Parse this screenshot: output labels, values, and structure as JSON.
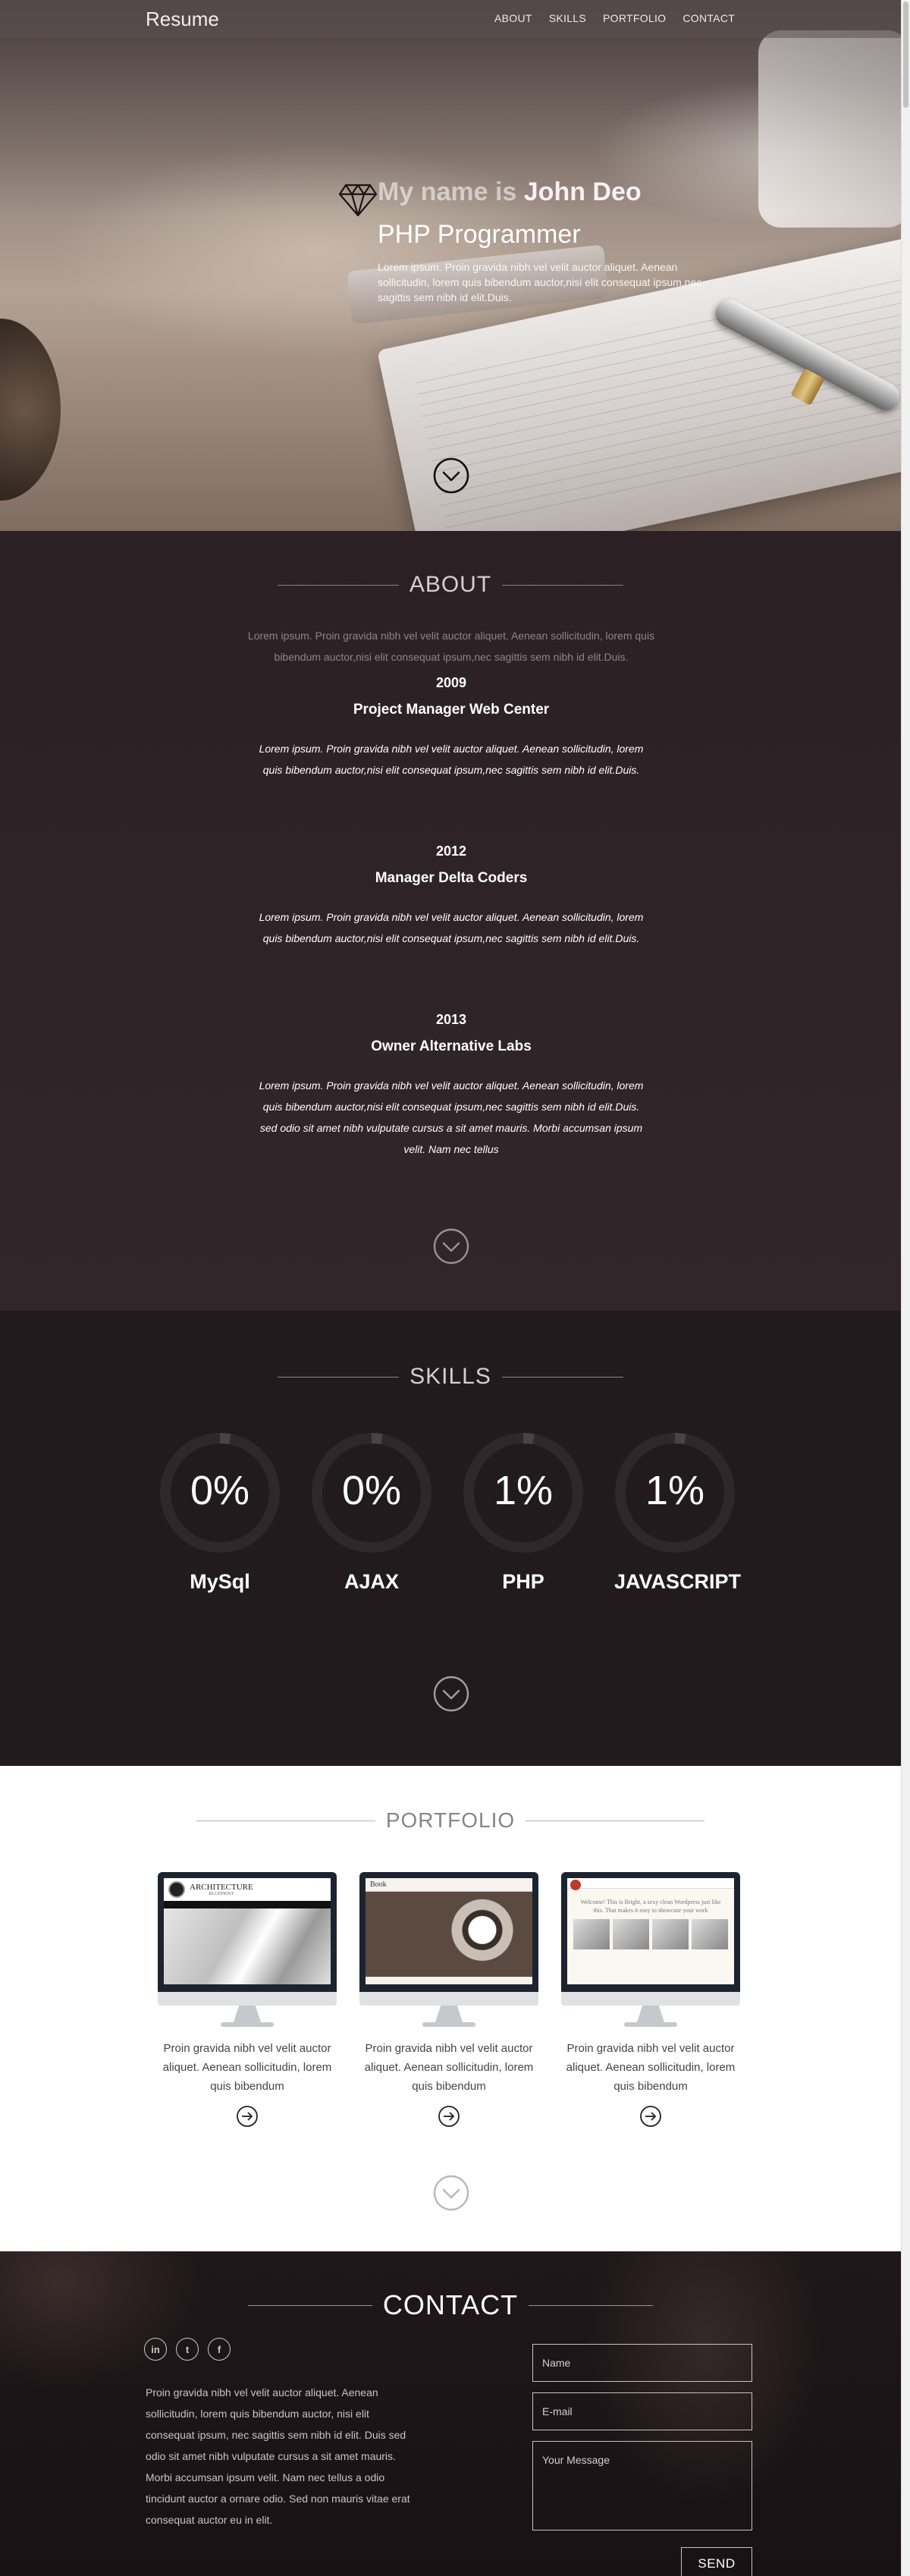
{
  "nav": {
    "brand": "Resume",
    "items": [
      "ABOUT",
      "SKILLS",
      "PORTFOLIO",
      "CONTACT"
    ]
  },
  "hero": {
    "name_prefix": "My name is",
    "name": "John Deo",
    "title": "PHP Programmer",
    "text": "Lorem ipsum. Proin gravida nibh vel velit auctor aliquet. Aenean sollicitudin, lorem quis bibendum auctor,nisi elit consequat ipsum,nec sagittis sem nibh id elit.Duis."
  },
  "about": {
    "title": "ABOUT",
    "intro": "Lorem ipsum. Proin gravida nibh vel velit auctor aliquet. Aenean sollicitudin, lorem quis bibendum auctor,nisi elit consequat ipsum,nec sagittis sem nibh id elit.Duis.",
    "jobs": [
      {
        "year": "2009",
        "title": "Project Manager Web Center",
        "desc": "Lorem ipsum. Proin gravida nibh vel velit auctor aliquet. Aenean sollicitudin, lorem quis bibendum auctor,nisi elit consequat ipsum,nec sagittis sem nibh id elit.Duis."
      },
      {
        "year": "2012",
        "title": "Manager Delta Coders",
        "desc": "Lorem ipsum. Proin gravida nibh vel velit auctor aliquet. Aenean sollicitudin, lorem quis bibendum auctor,nisi elit consequat ipsum,nec sagittis sem nibh id elit.Duis."
      },
      {
        "year": "2013",
        "title": "Owner Alternative Labs",
        "desc": "Lorem ipsum. Proin gravida nibh vel velit auctor aliquet. Aenean sollicitudin, lorem quis bibendum auctor,nisi elit consequat ipsum,nec sagittis sem nibh id elit.Duis. sed odio sit amet nibh vulputate cursus a sit amet mauris. Morbi accumsan ipsum velit. Nam nec tellus"
      }
    ]
  },
  "skills": {
    "title": "SKILLS",
    "items": [
      {
        "name": "MySql",
        "percent": "0%",
        "value": 0
      },
      {
        "name": "AJAX",
        "percent": "0%",
        "value": 0
      },
      {
        "name": "PHP",
        "percent": "1%",
        "value": 1
      },
      {
        "name": "JAVASCRIPT",
        "percent": "1%",
        "value": 1
      }
    ]
  },
  "portfolio": {
    "title": "PORTFOLIO",
    "items": [
      {
        "caption": "Proin gravida nibh vel velit auctor aliquet. Aenean sollicitudin, lorem quis bibendum",
        "screen_title": "ARCHITECTURE",
        "screen_subtitle": "BLUEPRINT"
      },
      {
        "caption": "Proin gravida nibh vel velit auctor aliquet. Aenean sollicitudin, lorem quis bibendum",
        "screen_title": "Book"
      },
      {
        "caption": "Proin gravida nibh vel velit auctor aliquet. Aenean sollicitudin, lorem quis bibendum",
        "screen_title": "Welcome! This is Bright, a sexy clean Wordpress just like this. That makes it easy to showcase your work"
      }
    ]
  },
  "contact": {
    "title": "CONTACT",
    "socials": [
      "in",
      "t",
      "f"
    ],
    "text": "Proin gravida nibh vel velit auctor aliquet. Aenean sollicitudin, lorem quis bibendum auctor, nisi elit consequat ipsum, nec sagittis sem nibh id elit. Duis sed odio sit amet nibh vulputate cursus a sit amet mauris. Morbi accumsan ipsum velit. Nam nec tellus a odio tincidunt auctor a ornare odio. Sed non mauris vitae erat consequat auctor eu in elit.",
    "name_placeholder": "Name",
    "email_placeholder": "E-mail",
    "message_placeholder": "Your Message",
    "send_label": "SEND"
  },
  "colors": {
    "accent": "#ffffff",
    "about_bg": "#2d2327",
    "skills_bg": "#221b1e",
    "ring_track": "#2f282b",
    "ring_fill": "#4a4346"
  }
}
